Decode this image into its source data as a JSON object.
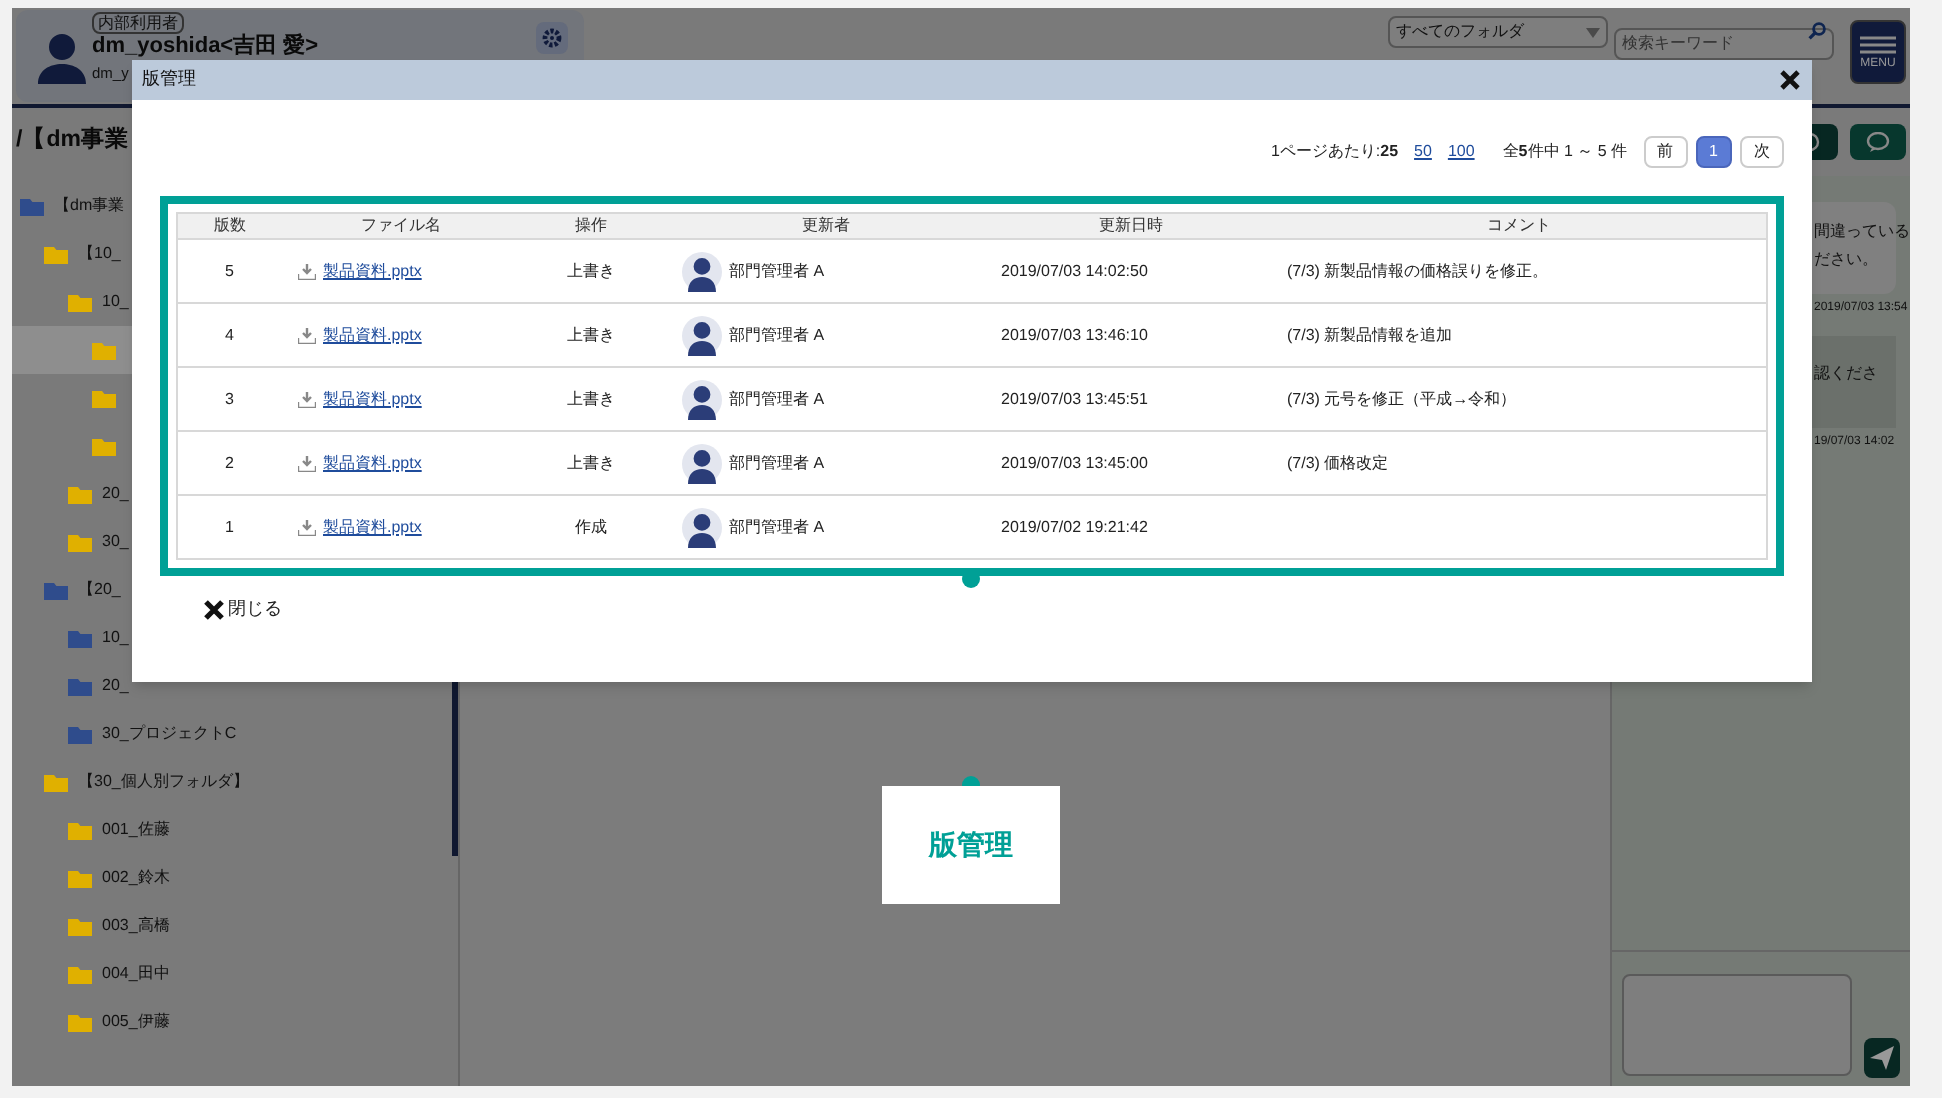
{
  "app": {
    "user_badge": "内部利用者",
    "user_name": "dm_yoshida<吉田 愛>",
    "user_id": "dm_y",
    "folder_select": "すべてのフォルダ",
    "search_placeholder": "検索キーワード",
    "menu_label": "MENU",
    "breadcrumb": "/【dm事業"
  },
  "sidebar": {
    "items": [
      {
        "label": "【dm事業",
        "color": "#2f4c8c",
        "selected": false,
        "children": [
          {
            "label": "【10_",
            "color": "#e0b000",
            "selected": false,
            "children": [
              {
                "label": "10_",
                "color": "#e0b000",
                "selected": false,
                "children": [
                  {
                    "color": "#e0b000",
                    "selected": true
                  },
                  {
                    "color": "#e0b000",
                    "selected": false
                  },
                  {
                    "color": "#e0b000",
                    "selected": false
                  }
                ]
              },
              {
                "label": "20_",
                "color": "#e0b000",
                "selected": false
              },
              {
                "label": "30_",
                "color": "#e0b000",
                "selected": false
              }
            ]
          },
          {
            "label": "【20_",
            "color": "#2f4c8c",
            "selected": false,
            "children": [
              {
                "label": "10_",
                "color": "#2f4c8c",
                "selected": false
              },
              {
                "label": "20_",
                "color": "#2f4c8c",
                "selected": false
              },
              {
                "label": "30_プロジェクトC",
                "color": "#2f4c8c",
                "selected": false
              }
            ]
          },
          {
            "label": "【30_個人別フォルダ】",
            "color": "#e0b000",
            "selected": false,
            "children": [
              {
                "label": "001_佐藤",
                "color": "#e0b000",
                "selected": false
              },
              {
                "label": "002_鈴木",
                "color": "#e0b000",
                "selected": false
              },
              {
                "label": "003_高橋",
                "color": "#e0b000",
                "selected": false
              },
              {
                "label": "004_田中",
                "color": "#e0b000",
                "selected": false
              },
              {
                "label": "005_伊藤",
                "color": "#e0b000",
                "selected": false
              }
            ]
          }
        ]
      }
    ]
  },
  "chat": {
    "messages": [
      {
        "kind": "received",
        "lines": [
          "間違っている",
          "ださい。"
        ],
        "time": "2019/07/03 13:54"
      },
      {
        "kind": "sent",
        "lines": [
          "認くださ"
        ],
        "time": "19/07/03 14:02"
      }
    ]
  },
  "modal": {
    "title": "版管理",
    "per_page": "1ページあたり:**25**",
    "per_page_options": [
      "50",
      "100"
    ],
    "total": "全**5**件中 1 ～ 5 件",
    "pages": [
      {
        "label": "前",
        "selected": false
      },
      {
        "label": "1",
        "selected": true
      },
      {
        "label": "次",
        "selected": false
      }
    ],
    "table": {
      "columns": [
        "版数",
        "ファイル名",
        "操作",
        "更新者",
        "更新日時",
        "コメント"
      ],
      "rows": [
        {
          "version": "5",
          "file": "製品資料.pptx",
          "operation": "上書き",
          "updater": "部門管理者 A",
          "updated_at": "2019/07/03 14:02:50",
          "comment": "(7/3) 新製品情報の価格誤りを修正。"
        },
        {
          "version": "4",
          "file": "製品資料.pptx",
          "operation": "上書き",
          "updater": "部門管理者 A",
          "updated_at": "2019/07/03 13:46:10",
          "comment": "(7/3) 新製品情報を追加"
        },
        {
          "version": "3",
          "file": "製品資料.pptx",
          "operation": "上書き",
          "updater": "部門管理者 A",
          "updated_at": "2019/07/03 13:45:51",
          "comment": "(7/3) 元号を修正（平成→令和）"
        },
        {
          "version": "2",
          "file": "製品資料.pptx",
          "operation": "上書き",
          "updater": "部門管理者 A",
          "updated_at": "2019/07/03 13:45:00",
          "comment": "(7/3) 価格改定"
        },
        {
          "version": "1",
          "file": "製品資料.pptx",
          "operation": "作成",
          "updater": "部門管理者 A",
          "updated_at": "2019/07/02 19:21:42"
        }
      ]
    },
    "close_label": "閉じる"
  },
  "callout": {
    "label": "版管理"
  }
}
